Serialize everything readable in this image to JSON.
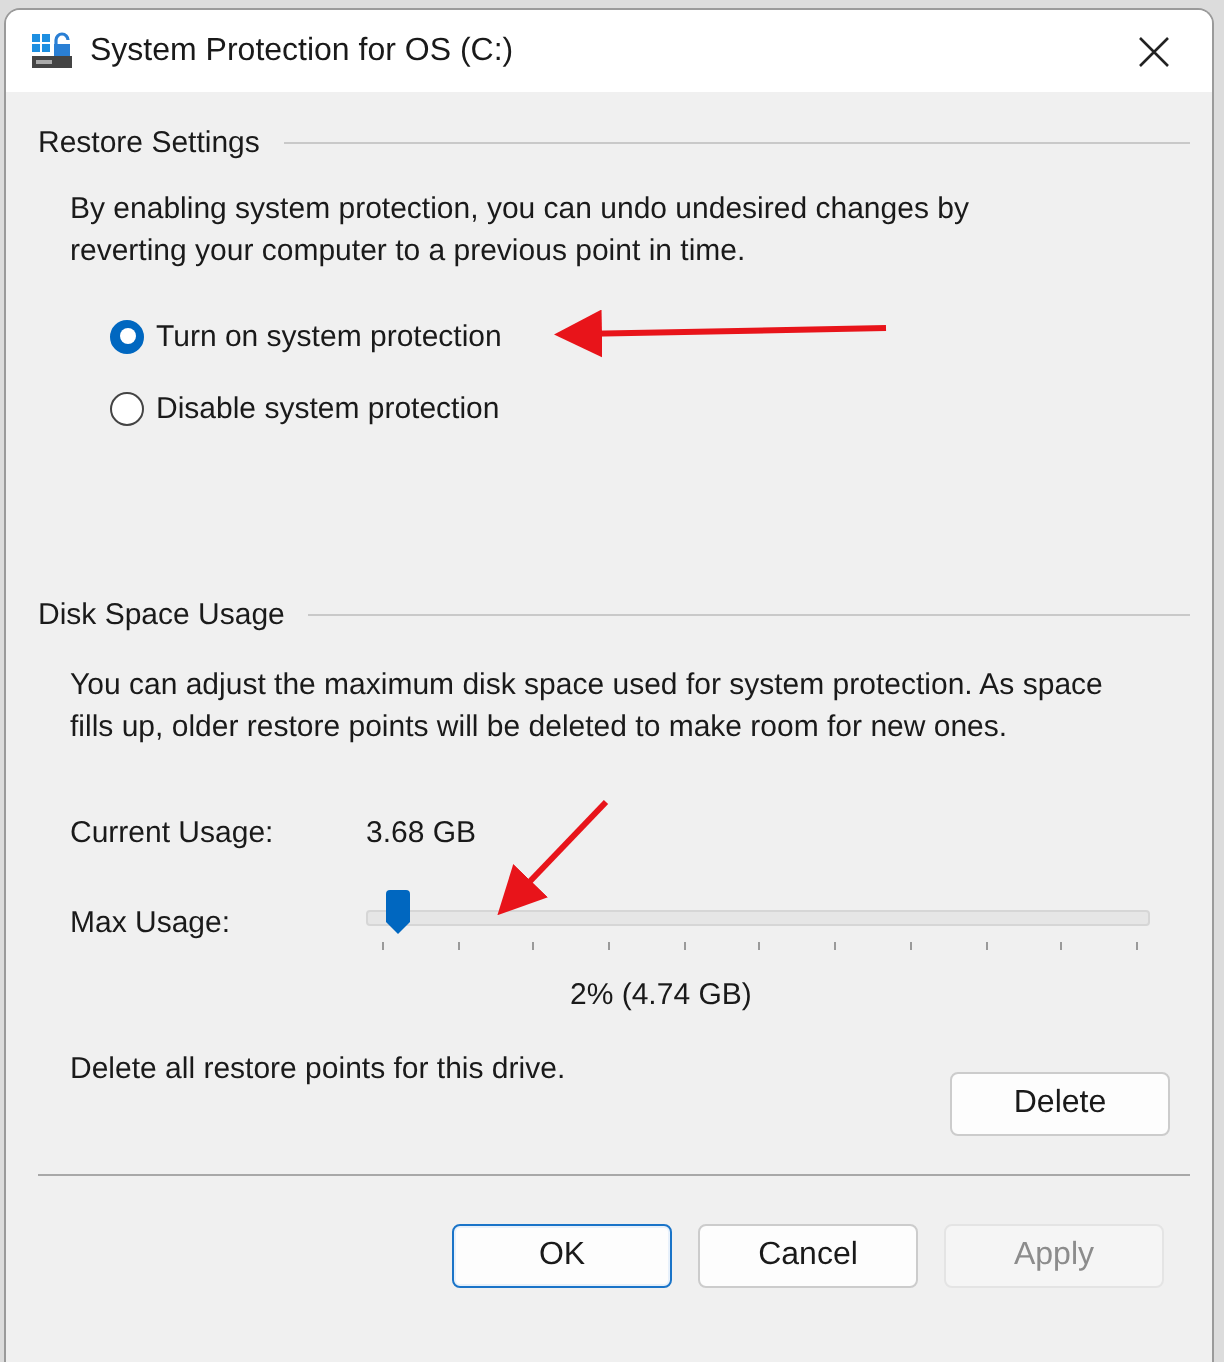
{
  "window": {
    "title": "System Protection for OS (C:)"
  },
  "restore_settings": {
    "heading": "Restore Settings",
    "description": "By enabling system protection, you can undo undesired changes by reverting your computer to a previous point in time.",
    "options": [
      {
        "label": "Turn on system protection",
        "selected": true
      },
      {
        "label": "Disable system protection",
        "selected": false
      }
    ]
  },
  "disk_space_usage": {
    "heading": "Disk Space Usage",
    "description": "You can adjust the maximum disk space used for system protection. As space fills up, older restore points will be deleted to make room for new ones.",
    "current_usage_label": "Current Usage:",
    "current_usage_value": "3.68 GB",
    "max_usage_label": "Max Usage:",
    "max_usage": {
      "level": 0.02
    },
    "max_usage_reading": "2% (4.74 GB)",
    "delete_text": "Delete all restore points for this drive.",
    "delete_button": "Delete"
  },
  "buttons": [
    {
      "label": "OK",
      "default": true,
      "disabled": false
    },
    {
      "label": "Cancel",
      "default": false,
      "disabled": false
    },
    {
      "label": "Apply",
      "default": false,
      "disabled": true
    }
  ]
}
